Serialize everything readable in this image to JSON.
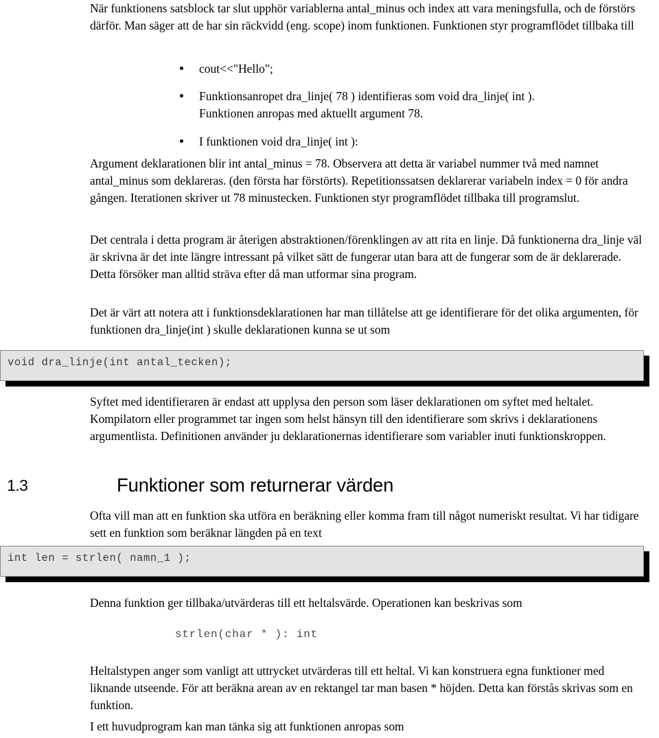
{
  "document": {
    "language": "sv",
    "body_paragraphs": [
      {
        "id": "p-intro",
        "text": "När funktionens satsblock tar slut upphör variablerna antal_minus och index att vara meningsfulla, och de förstörs därför. Man säger att de har sin räckvidd (eng. scope) inom funktionen. Funktionen styr programflödet tillbaka till"
      },
      {
        "id": "p-argument",
        "text": "Argument deklarationen blir int antal_minus =  78. Observera att detta är variabel nummer två med namnet antal_minus som deklareras. (den första har förstörts).  Repetitionssatsen deklarerar variabeln index = 0 för andra gången. Iterationen skriver ut 78 minustecken. Funktionen styr programflödet tillbaka till programslut."
      },
      {
        "id": "p-abstraktion",
        "text": "Det centrala i detta program är återigen abstraktionen/förenklingen av att rita en linje. Då funktionerna dra_linje väl är skrivna är det inte längre intressant på vilket sätt de fungerar utan bara att de fungerar som de är deklarerade. Detta försöker man alltid sträva efter då man utformar sina program."
      },
      {
        "id": "p-identifierare",
        "text": "Det är värt att notera att i funktionsdeklarationen har man tillåtelse att ge identifierare för det olika argumenten, för funktionen dra_linje(int ) skulle deklarationen kunna se ut som"
      },
      {
        "id": "p-syftet",
        "text": "Syftet med identifieraren är endast att upplysa den person som läser deklarationen om syftet med heltalet. Kompilatorn eller programmet tar ingen som helst hänsyn till den identifierare som skrivs i deklarationens argumentlista. Definitionen använder ju deklarationernas identifierare som variabler inuti funktionskroppen."
      },
      {
        "id": "p-ofta",
        "text": "Ofta vill man att en funktion ska utföra en beräkning eller komma fram till något numeriskt resultat. Vi har tidigare sett en funktion som beräknar längden på en text"
      },
      {
        "id": "p-denna",
        "text": "Denna funktion ger tillbaka/utvärderas till ett heltalsvärde. Operationen kan beskrivas som"
      },
      {
        "id": "p-heltalstypen",
        "text": "Heltalstypen anger som vanligt att uttrycket utvärderas till ett heltal. Vi kan konstruera egna funktioner med liknande utseende. För att beräkna arean av en rektangel tar man basen * höjden. Detta kan förstås skrivas som en funktion."
      },
      {
        "id": "p-huvudprogram",
        "text": "I ett huvudprogram kan man tänka sig att funktionen anropas som"
      }
    ],
    "bullet_list": [
      {
        "text": "cout<<\"Hello\";"
      },
      {
        "text": "Funktionsanropet dra_linje( 78 ) identifieras som void dra_linje( int ). Funktionen anropas med aktuellt argument 78."
      },
      {
        "text": "I funktionen void dra_linje( int ):"
      }
    ],
    "code_blocks": [
      {
        "id": "code-declaration",
        "text": "void dra_linje(int antal_tecken);"
      },
      {
        "id": "code-strlen-call",
        "text": "int len = strlen( namn_1 );"
      }
    ],
    "mono_lines": [
      {
        "id": "mono-strlen-signature",
        "text": "strlen(char * ): int"
      }
    ],
    "heading": {
      "number": "1.3",
      "title": "Funktioner som returnerar värden"
    },
    "colors": {
      "page_background": "#ffffff",
      "text": "#000000",
      "code_background": "#e3e3e3",
      "code_border": "#8a8a8a",
      "code_text": "#3a3a3a",
      "code_shadow": "#000000"
    }
  }
}
